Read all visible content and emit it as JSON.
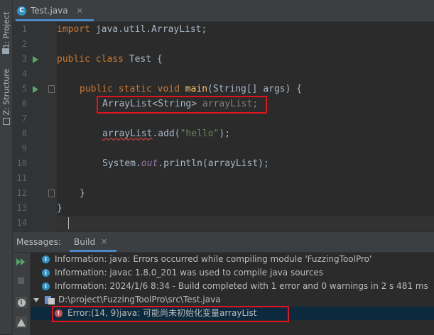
{
  "sidebar": {
    "project_tab": "1: Project",
    "structure_tab": "Z: Structure"
  },
  "editor": {
    "file_tab": "Test.java",
    "line_numbers": [
      "1",
      "2",
      "3",
      "4",
      "5",
      "6",
      "7",
      "8",
      "9",
      "10",
      "11",
      "12",
      "13",
      "14"
    ],
    "lines": {
      "l1": {
        "kw": "import",
        "rest": " java.util.ArrayList;"
      },
      "l3": {
        "kw1": "public",
        "kw2": "class",
        "rest": " Test {"
      },
      "l5": {
        "kw1": "public",
        "kw2": "static",
        "kw3": "void",
        "method": "main",
        "rest": "(String[] args) {"
      },
      "l6": {
        "type": "ArrayList<String>",
        "var": " arrayList;"
      },
      "l8": {
        "var": "arrayList",
        "call": ".add(",
        "str": "\"hello\"",
        "end": ");"
      },
      "l10": {
        "cls": "System.",
        "field": "out",
        "rest": ".println(arrayList);"
      },
      "l12": {
        "text": "}"
      },
      "l13": {
        "text": "}"
      }
    }
  },
  "messages_panel": {
    "label": "Messages:",
    "tab": "Build",
    "items": [
      {
        "type": "info",
        "text": "Information: java: Errors occurred while compiling module 'FuzzingToolPro'"
      },
      {
        "type": "info",
        "text": "Information: javac 1.8.0_201 was used to compile java sources"
      },
      {
        "type": "info",
        "text": "Information: 2024/1/6 8:34 - Build completed with 1 error and 0 warnings in 2 s 481 ms"
      }
    ],
    "file_node": "D:\\project\\FuzzingToolPro\\src\\Test.java",
    "error": {
      "location": "Error:(14, 9)",
      "message": "  java: 可能尚未初始化变量arrayList"
    }
  },
  "colors": {
    "keyword": "#cc7832",
    "method": "#ffc66d",
    "string": "#6a8759",
    "field": "#9876aa",
    "text": "#a9b7c6",
    "highlight": "#e0141e"
  }
}
